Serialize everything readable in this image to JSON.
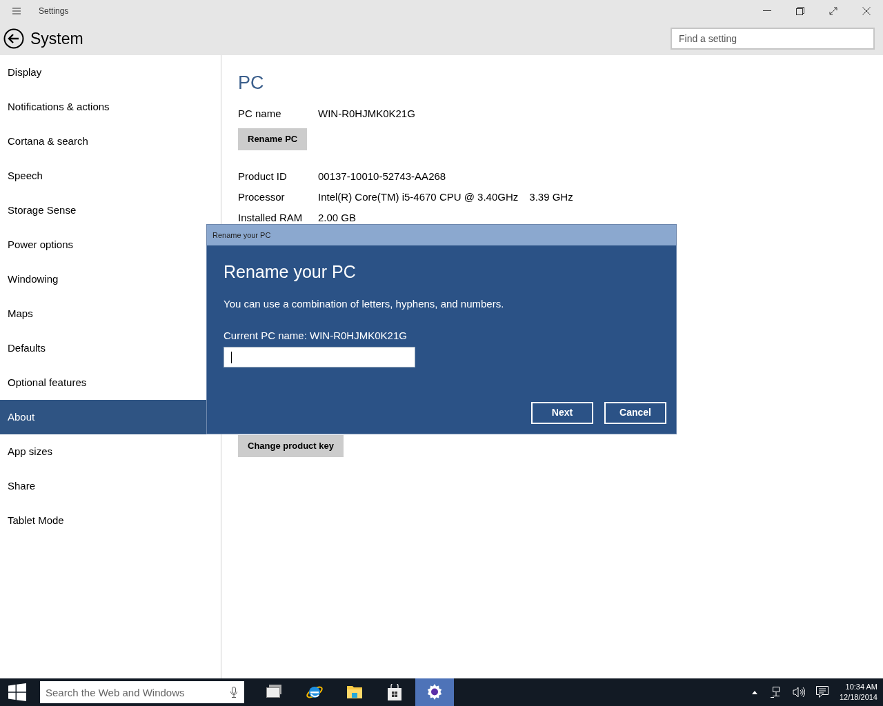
{
  "window": {
    "title": "Settings"
  },
  "header": {
    "title": "System",
    "search": {
      "placeholder": "Find a setting"
    }
  },
  "sidebar": {
    "items": [
      {
        "label": "Display",
        "selected": false
      },
      {
        "label": "Notifications & actions",
        "selected": false
      },
      {
        "label": "Cortana & search",
        "selected": false
      },
      {
        "label": "Speech",
        "selected": false
      },
      {
        "label": "Storage Sense",
        "selected": false
      },
      {
        "label": "Power options",
        "selected": false
      },
      {
        "label": "Windowing",
        "selected": false
      },
      {
        "label": "Maps",
        "selected": false
      },
      {
        "label": "Defaults",
        "selected": false
      },
      {
        "label": "Optional features",
        "selected": false
      },
      {
        "label": "About",
        "selected": true
      },
      {
        "label": "App sizes",
        "selected": false
      },
      {
        "label": "Share",
        "selected": false
      },
      {
        "label": "Tablet Mode",
        "selected": false
      }
    ]
  },
  "content": {
    "heading": "PC",
    "pc_name": {
      "label": "PC name",
      "value": "WIN-R0HJMK0K21G"
    },
    "rename_button": "Rename PC",
    "specs": [
      {
        "label": "Product ID",
        "values": [
          "00137-10010-52743-AA268"
        ]
      },
      {
        "label": "Processor",
        "values": [
          "Intel(R) Core(TM) i5-4670 CPU @ 3.40GHz",
          "3.39 GHz"
        ]
      },
      {
        "label": "Installed RAM",
        "values": [
          "2.00 GB"
        ]
      }
    ],
    "product_key_button": "Change product key"
  },
  "dialog": {
    "title": "Rename your PC",
    "heading": "Rename your PC",
    "description": "You can use a combination of letters, hyphens, and numbers.",
    "current_name": "Current PC name: WIN-R0HJMK0K21G",
    "buttons": [
      "Next",
      "Cancel"
    ]
  },
  "taskbar": {
    "search": {
      "placeholder": "Search the Web and Windows"
    },
    "apps": [
      {
        "kind": "task-view",
        "selected": false
      },
      {
        "kind": "browser",
        "selected": false
      },
      {
        "kind": "folder",
        "selected": false
      },
      {
        "kind": "store",
        "selected": false
      },
      {
        "kind": "settings",
        "selected": true
      }
    ],
    "clock": {
      "time": "10:34 AM",
      "date": "12/18/2014"
    }
  }
}
